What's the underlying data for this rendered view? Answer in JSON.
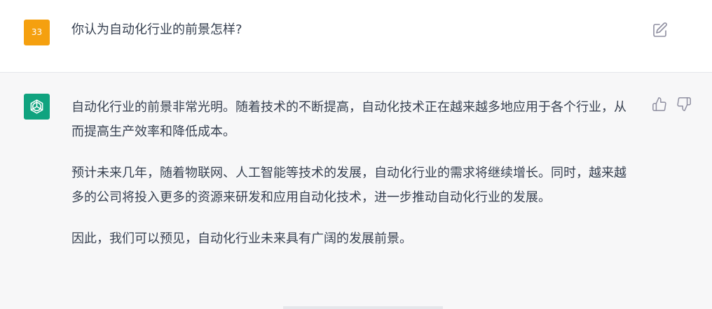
{
  "user_message": {
    "avatar_label": "33",
    "avatar_color": "#f5a00f",
    "text": "你认为自动化行业的前景怎样?",
    "edit_icon": "edit-icon"
  },
  "assistant_message": {
    "avatar_icon": "openai-logo-icon",
    "avatar_color": "#10a37f",
    "paragraphs": [
      "自动化行业的前景非常光明。随着技术的不断提高，自动化技术正在越来越多地应用于各个行业，从而提高生产效率和降低成本。",
      "预计未来几年，随着物联网、人工智能等技术的发展，自动化行业的需求将继续增长。同时，越来越多的公司将投入更多的资源来研发和应用自动化技术，进一步推动自动化行业的发展。",
      "因此，我们可以预见，自动化行业未来具有广阔的发展前景。"
    ],
    "feedback_icons": [
      "thumbs-up-icon",
      "thumbs-down-icon"
    ]
  }
}
